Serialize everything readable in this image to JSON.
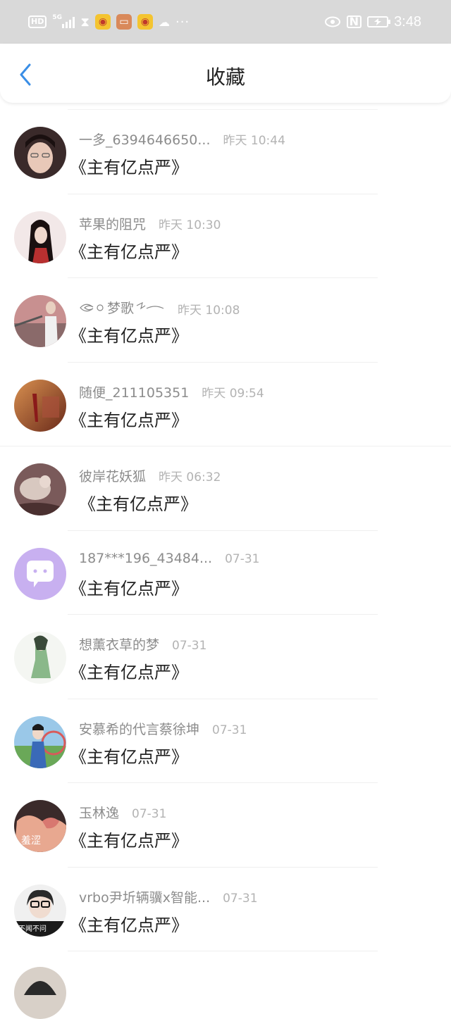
{
  "status_bar": {
    "hd": "HD",
    "network": "5G",
    "time": "3:48",
    "dots": "···",
    "nfc": "N"
  },
  "header": {
    "title": "收藏"
  },
  "items": [
    {
      "username": "一多_6394646650...",
      "time": "昨天 10:44",
      "content": "《主有亿点严》",
      "avatar_colors": [
        "#3a2a2a",
        "#e8c8b8"
      ]
    },
    {
      "username": "苹果的阻咒",
      "time": "昨天 10:30",
      "content": "《主有亿点严》",
      "avatar_colors": [
        "#f2e8e8",
        "#2a1a1a"
      ]
    },
    {
      "username": "梦歌",
      "time": "昨天 10:08",
      "content": "《主有亿点严》",
      "avatar_colors": [
        "#c89090",
        "#f0f0f0"
      ]
    },
    {
      "username": "随便_211105351",
      "time": "昨天 09:54",
      "content": "《主有亿点严》",
      "avatar_colors": [
        "#8a4a2a",
        "#e8a060"
      ]
    },
    {
      "username": "彼岸花妖狐",
      "time": "昨天 06:32",
      "content": "《主有亿点严》",
      "avatar_colors": [
        "#7a5a5a",
        "#d8c8c0"
      ]
    },
    {
      "username": "187***196_43484...",
      "time": "07-31",
      "content": "《主有亿点严》",
      "avatar_colors": [
        "#c8b0f0",
        "#ffffff"
      ]
    },
    {
      "username": "想薰衣草的梦",
      "time": "07-31",
      "content": "《主有亿点严》",
      "avatar_colors": [
        "#f4f6f2",
        "#6a9a6a"
      ]
    },
    {
      "username": "安慕希的代言蔡徐坤",
      "time": "07-31",
      "content": "《主有亿点严》",
      "avatar_colors": [
        "#6aa858",
        "#d85a5a"
      ]
    },
    {
      "username": "玉林逸",
      "time": "07-31",
      "content": "《主有亿点严》",
      "avatar_colors": [
        "#3a2a2a",
        "#e8a890"
      ]
    },
    {
      "username": "vrbo尹圻辆骥x智能...",
      "time": "07-31",
      "content": "《主有亿点严》",
      "avatar_colors": [
        "#f0f0f0",
        "#2a2a2a"
      ]
    }
  ],
  "avatar_text": {
    "item9": "羞涩",
    "item10": "不闻不问"
  }
}
